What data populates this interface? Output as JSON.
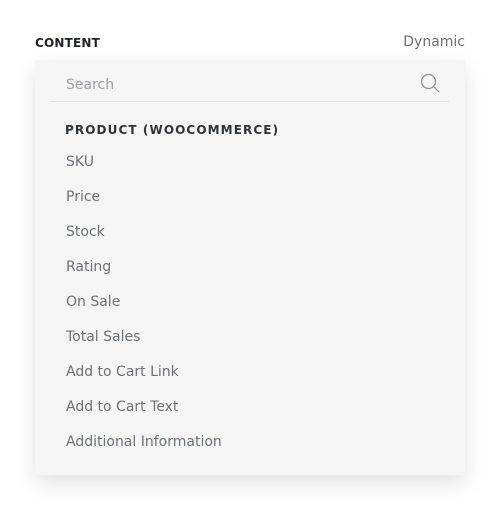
{
  "header": {
    "label": "CONTENT",
    "mode": "Dynamic"
  },
  "dropdown": {
    "search": {
      "placeholder": "Search",
      "value": ""
    },
    "section_title": "PRODUCT (WOOCOMMERCE)",
    "items": [
      {
        "label": "SKU"
      },
      {
        "label": "Price"
      },
      {
        "label": "Stock"
      },
      {
        "label": "Rating"
      },
      {
        "label": "On Sale"
      },
      {
        "label": "Total Sales"
      },
      {
        "label": "Add to Cart Link"
      },
      {
        "label": "Add to Cart Text"
      },
      {
        "label": "Additional Information"
      }
    ]
  },
  "icons": {
    "search": "search-icon"
  },
  "colors": {
    "panel_bg": "#f5f5f5",
    "item_text": "#6c7177",
    "section_text": "#2f3338",
    "header_text": "#1f2328"
  }
}
